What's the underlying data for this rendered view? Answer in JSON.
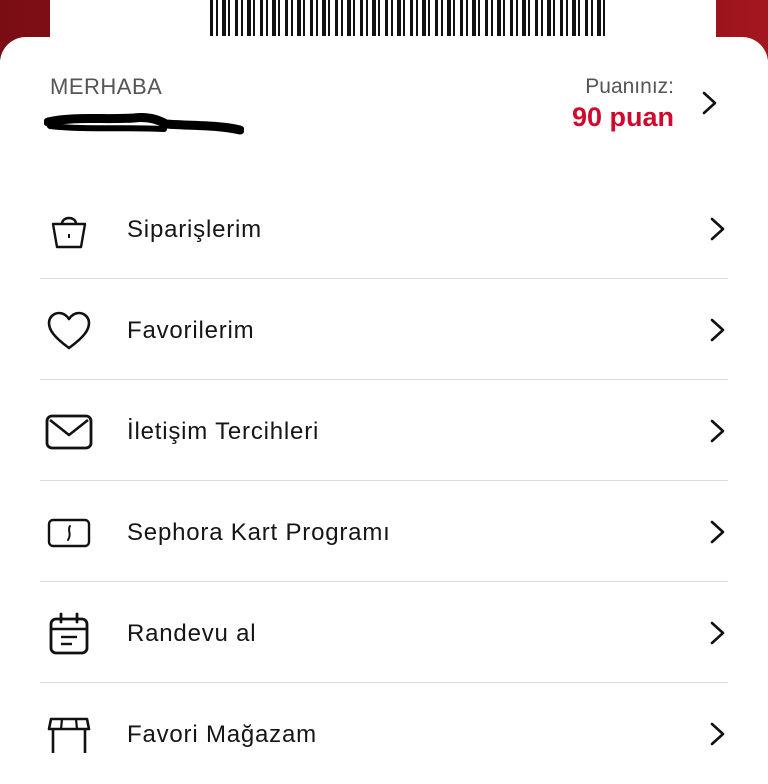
{
  "header": {
    "greeting": "MERHABA",
    "points_label": "Puanınız:",
    "points_value": "90 puan"
  },
  "colors": {
    "accent": "#cf0a2c",
    "card_red": "#8c1019"
  },
  "menu": {
    "items": [
      {
        "label": "Siparişlerim",
        "icon": "shopping-bag-icon"
      },
      {
        "label": "Favorilerim",
        "icon": "heart-icon"
      },
      {
        "label": "İletişim Tercihleri",
        "icon": "envelope-icon"
      },
      {
        "label": "Sephora Kart Programı",
        "icon": "card-icon"
      },
      {
        "label": "Randevu al",
        "icon": "calendar-icon"
      },
      {
        "label": "Favori Mağazam",
        "icon": "store-icon"
      }
    ]
  }
}
